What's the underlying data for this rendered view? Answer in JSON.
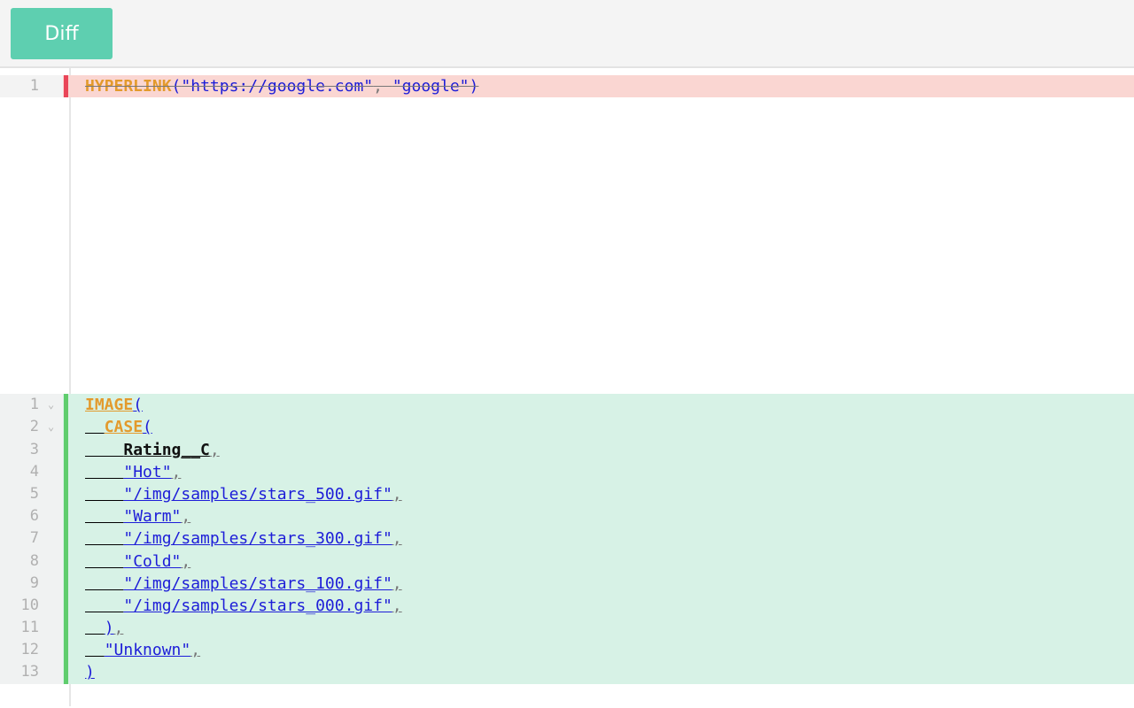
{
  "toolbar": {
    "diff_label": "Diff"
  },
  "removed": {
    "lines": [
      {
        "number": "1",
        "tokens": [
          {
            "type": "kw",
            "text": "HYPERLINK"
          },
          {
            "type": "pn",
            "text": "("
          },
          {
            "type": "st",
            "text": "\"https://google.com\""
          },
          {
            "type": "cm",
            "text": ","
          },
          {
            "type": "ws",
            "text": " "
          },
          {
            "type": "st",
            "text": "\"google\""
          },
          {
            "type": "pn",
            "text": ")"
          }
        ]
      }
    ]
  },
  "added": {
    "lines": [
      {
        "number": "1",
        "fold": true,
        "tokens": [
          {
            "type": "kw",
            "text": "IMAGE"
          },
          {
            "type": "pn",
            "text": "("
          }
        ]
      },
      {
        "number": "2",
        "fold": true,
        "tokens": [
          {
            "type": "ws",
            "text": "  "
          },
          {
            "type": "kw",
            "text": "CASE"
          },
          {
            "type": "pn",
            "text": "("
          }
        ]
      },
      {
        "number": "3",
        "tokens": [
          {
            "type": "ws",
            "text": "    "
          },
          {
            "type": "id",
            "text": "Rating__C"
          },
          {
            "type": "cm",
            "text": ","
          }
        ]
      },
      {
        "number": "4",
        "tokens": [
          {
            "type": "ws",
            "text": "    "
          },
          {
            "type": "st",
            "text": "\"Hot\""
          },
          {
            "type": "cm",
            "text": ","
          }
        ]
      },
      {
        "number": "5",
        "tokens": [
          {
            "type": "ws",
            "text": "    "
          },
          {
            "type": "st",
            "text": "\"/img/samples/stars_500.gif\""
          },
          {
            "type": "cm",
            "text": ","
          }
        ]
      },
      {
        "number": "6",
        "tokens": [
          {
            "type": "ws",
            "text": "    "
          },
          {
            "type": "st",
            "text": "\"Warm\""
          },
          {
            "type": "cm",
            "text": ","
          }
        ]
      },
      {
        "number": "7",
        "tokens": [
          {
            "type": "ws",
            "text": "    "
          },
          {
            "type": "st",
            "text": "\"/img/samples/stars_300.gif\""
          },
          {
            "type": "cm",
            "text": ","
          }
        ]
      },
      {
        "number": "8",
        "tokens": [
          {
            "type": "ws",
            "text": "    "
          },
          {
            "type": "st",
            "text": "\"Cold\""
          },
          {
            "type": "cm",
            "text": ","
          }
        ]
      },
      {
        "number": "9",
        "tokens": [
          {
            "type": "ws",
            "text": "    "
          },
          {
            "type": "st",
            "text": "\"/img/samples/stars_100.gif\""
          },
          {
            "type": "cm",
            "text": ","
          }
        ]
      },
      {
        "number": "10",
        "tokens": [
          {
            "type": "ws",
            "text": "    "
          },
          {
            "type": "st",
            "text": "\"/img/samples/stars_000.gif\""
          },
          {
            "type": "cm",
            "text": ","
          }
        ]
      },
      {
        "number": "11",
        "tokens": [
          {
            "type": "ws",
            "text": "  "
          },
          {
            "type": "pn",
            "text": ")"
          },
          {
            "type": "cm",
            "text": ","
          }
        ]
      },
      {
        "number": "12",
        "tokens": [
          {
            "type": "ws",
            "text": "  "
          },
          {
            "type": "st",
            "text": "\"Unknown\""
          },
          {
            "type": "cm",
            "text": ","
          }
        ]
      },
      {
        "number": "13",
        "tokens": [
          {
            "type": "pn",
            "text": ")"
          }
        ]
      }
    ]
  },
  "colors": {
    "diff_button": "#5ecfb0",
    "removed_bg": "#fad6d2",
    "removed_marker": "#e94558",
    "added_bg": "#d7f2e6",
    "added_marker": "#5fcd6d",
    "keyword": "#e39a2c",
    "string": "#1d1dd8",
    "identifier": "#111111"
  }
}
